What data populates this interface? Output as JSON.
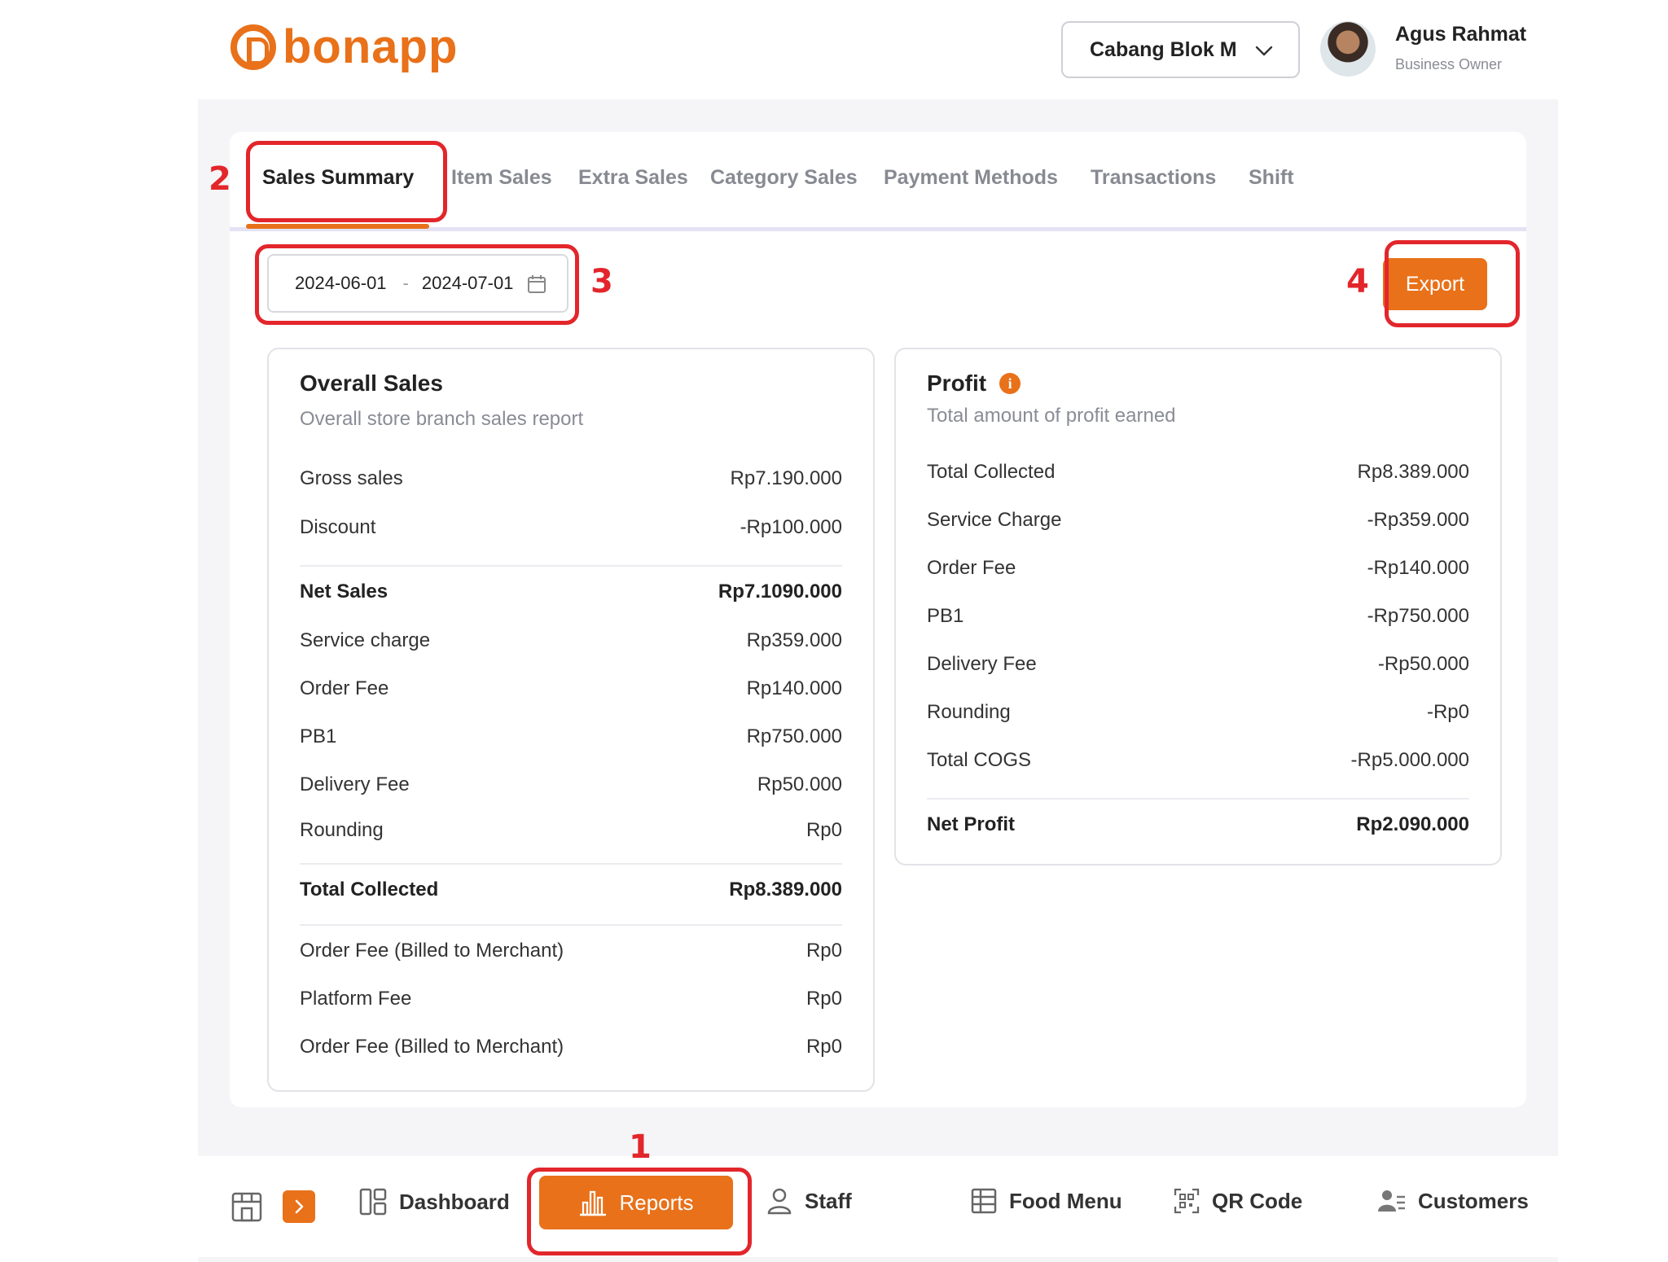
{
  "app": {
    "logo_text": "bonapp",
    "brand_color": "#e8711a"
  },
  "header": {
    "branch": "Cabang Blok M",
    "user_name": "Agus Rahmat",
    "user_role": "Business Owner"
  },
  "tabs": [
    {
      "label": "Sales Summary",
      "active": true
    },
    {
      "label": "Item Sales"
    },
    {
      "label": "Extra Sales"
    },
    {
      "label": "Category Sales"
    },
    {
      "label": "Payment Methods"
    },
    {
      "label": "Transactions"
    },
    {
      "label": "Shift"
    }
  ],
  "filters": {
    "date_from": "2024-06-01",
    "date_sep": "-",
    "date_to": "2024-07-01",
    "export_label": "Export"
  },
  "overall_sales": {
    "title": "Overall Sales",
    "subtitle": "Overall store branch sales report",
    "rows": [
      {
        "label": "Gross sales",
        "value": "Rp7.190.000"
      },
      {
        "label": "Discount",
        "value": "-Rp100.000"
      },
      {
        "label": "Net Sales",
        "value": "Rp7.1090.000"
      },
      {
        "label": "Service charge",
        "value": "Rp359.000"
      },
      {
        "label": "Order Fee",
        "value": "Rp140.000"
      },
      {
        "label": "PB1",
        "value": "Rp750.000"
      },
      {
        "label": "Delivery Fee",
        "value": "Rp50.000"
      },
      {
        "label": "Rounding",
        "value": "Rp0"
      },
      {
        "label": "Total Collected",
        "value": "Rp8.389.000"
      },
      {
        "label": "Order Fee (Billed to Merchant)",
        "value": "Rp0"
      },
      {
        "label": "Platform Fee",
        "value": "Rp0"
      },
      {
        "label": "Order Fee (Billed to Merchant)",
        "value": "Rp0"
      }
    ]
  },
  "profit": {
    "title": "Profit",
    "subtitle": "Total amount of profit earned",
    "rows": [
      {
        "label": "Total Collected",
        "value": "Rp8.389.000"
      },
      {
        "label": "Service Charge",
        "value": "-Rp359.000"
      },
      {
        "label": "Order Fee",
        "value": "-Rp140.000"
      },
      {
        "label": "PB1",
        "value": "-Rp750.000"
      },
      {
        "label": "Delivery Fee",
        "value": "-Rp50.000"
      },
      {
        "label": "Rounding",
        "value": "-Rp0"
      },
      {
        "label": "Total COGS",
        "value": "-Rp5.000.000"
      },
      {
        "label": "Net Profit",
        "value": "Rp2.090.000"
      }
    ]
  },
  "bottom_nav": {
    "dashboard": "Dashboard",
    "reports": "Reports",
    "staff": "Staff",
    "food_menu": "Food Menu",
    "qr_code": "QR Code",
    "customers": "Customers"
  },
  "annotations": {
    "n1": "1",
    "n2": "2",
    "n3": "3",
    "n4": "4",
    "color": "#e2262b"
  }
}
